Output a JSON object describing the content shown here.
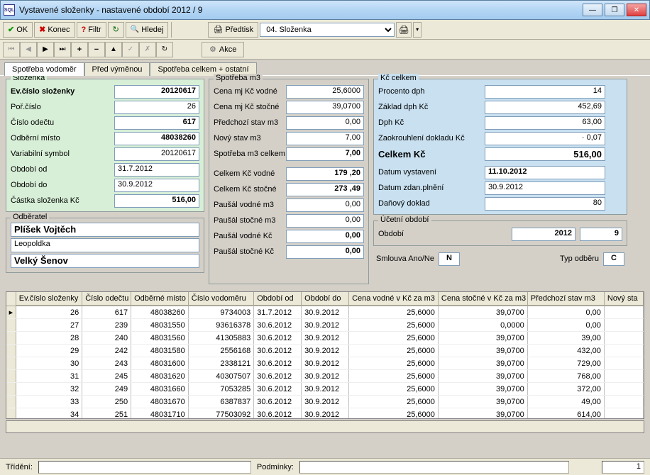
{
  "window": {
    "title": "Vystavené složenky - nastavené období 2012 / 9"
  },
  "toolbar": {
    "ok": "OK",
    "konec": "Konec",
    "filtr": "Filtr",
    "hledej": "Hledej",
    "predtisk": "Předtisk",
    "combo": "04. Složenka",
    "akce": "Akce"
  },
  "tabs": {
    "t1": "Spotřeba vodoměr",
    "t2": "Před výměnou",
    "t3": "Spotřeba celkem + ostatní"
  },
  "slozenka": {
    "legend": "Složenka",
    "evcislo_lbl": "Ev.číslo složenky",
    "evcislo": "20120617",
    "porcislo_lbl": "Poř.číslo",
    "porcislo": "26",
    "cisloodectu_lbl": "Číslo odečtu",
    "cisloodectu": "617",
    "odbmisto_lbl": "Odběrní místo",
    "odbmisto": "48038260",
    "vs_lbl": "Variabilní symbol",
    "vs": "20120617",
    "obdod_lbl": "Období od",
    "obdod": "31.7.2012",
    "obddo_lbl": "Období do",
    "obddo": "30.9.2012",
    "castka_lbl": "Částka složenka Kč",
    "castka": "516,00"
  },
  "odberatel": {
    "legend": "Odběratel",
    "name": "Plíšek Vojtěch",
    "street": "Leopoldka",
    "city": "Velký Šenov"
  },
  "spotreba": {
    "legend": "Spotřeba m3",
    "cenav_lbl": "Cena mj Kč vodné",
    "cenav": "25,6000",
    "cenas_lbl": "Cena mj Kč stočné",
    "cenas": "39,0700",
    "predstav_lbl": "Předchozí stav m3",
    "predstav": "0,00",
    "novystav_lbl": "Nový stav m3",
    "novystav": "7,00",
    "celkemm3_lbl": "Spotřeba m3 celkem",
    "celkemm3": "7,00",
    "celkemv_lbl": "Celkem Kč vodné",
    "celkemv": "179 ,20",
    "celkems_lbl": "Celkem Kč stočné",
    "celkems": "273 ,49",
    "pvm3_lbl": "Paušál vodné m3",
    "pvm3": "0,00",
    "psm3_lbl": "Paušál stočné m3",
    "psm3": "0,00",
    "pvkc_lbl": "Paušál vodné Kč",
    "pvkc": "0,00",
    "pskc_lbl": "Paušál stočné Kč",
    "pskc": "0,00"
  },
  "kc": {
    "legend": "Kč celkem",
    "dphproc_lbl": "Procento dph",
    "dphproc": "14",
    "zaklad_lbl": "Základ dph Kč",
    "zaklad": "452,69",
    "dphkc_lbl": "Dph Kč",
    "dphkc": "63,00",
    "zaok_lbl": "Zaokrouhlení dokladu Kč",
    "zaok": "·   0,07",
    "celkem_lbl": "Celkem Kč",
    "celkem": "516,00",
    "datvyst_lbl": "Datum vystavení",
    "datvyst": "11.10.2012",
    "datzdan_lbl": "Datum zdan.plnění",
    "datzdan": "30.9.2012",
    "dandokl_lbl": "Daňový doklad",
    "dandokl": "80"
  },
  "ucet": {
    "legend": "Účetní období",
    "obdobi_lbl": "Období",
    "rok": "2012",
    "mes": "9",
    "smlouva_lbl": "Smlouva Ano/Ne",
    "smlouva": "N",
    "typ_lbl": "Typ odběru",
    "typ": "C"
  },
  "grid": {
    "headers": {
      "ev": "Ev.číslo složenky",
      "od": "Číslo odečtu",
      "om": "Odběrné místo",
      "vod": "Číslo vodoměru",
      "obo": "Období od",
      "obd": "Období do",
      "cv": "Cena vodné v Kč za m3",
      "cs": "Cena stočné v Kč za m3",
      "ps": "Předchozí stav m3",
      "ns": "Nový sta"
    },
    "rows": [
      {
        "ev": "26",
        "od": "617",
        "om": "48038260",
        "vod": "9734003",
        "obo": "31.7.2012",
        "obd": "30.9.2012",
        "cv": "25,6000",
        "cs": "39,0700",
        "ps": "0,00"
      },
      {
        "ev": "27",
        "od": "239",
        "om": "48031550",
        "vod": "93616378",
        "obo": "30.6.2012",
        "obd": "30.9.2012",
        "cv": "25,6000",
        "cs": "0,0000",
        "ps": "0,00"
      },
      {
        "ev": "28",
        "od": "240",
        "om": "48031560",
        "vod": "41305883",
        "obo": "30.6.2012",
        "obd": "30.9.2012",
        "cv": "25,6000",
        "cs": "39,0700",
        "ps": "39,00"
      },
      {
        "ev": "29",
        "od": "242",
        "om": "48031580",
        "vod": "2556168",
        "obo": "30.6.2012",
        "obd": "30.9.2012",
        "cv": "25,6000",
        "cs": "39,0700",
        "ps": "432,00"
      },
      {
        "ev": "30",
        "od": "243",
        "om": "48031600",
        "vod": "2338121",
        "obo": "30.6.2012",
        "obd": "30.9.2012",
        "cv": "25,6000",
        "cs": "39,0700",
        "ps": "729,00"
      },
      {
        "ev": "31",
        "od": "245",
        "om": "48031620",
        "vod": "40307507",
        "obo": "30.6.2012",
        "obd": "30.9.2012",
        "cv": "25,6000",
        "cs": "39,0700",
        "ps": "768,00"
      },
      {
        "ev": "32",
        "od": "249",
        "om": "48031660",
        "vod": "7053285",
        "obo": "30.6.2012",
        "obd": "30.9.2012",
        "cv": "25,6000",
        "cs": "39,0700",
        "ps": "372,00"
      },
      {
        "ev": "33",
        "od": "250",
        "om": "48031670",
        "vod": "6387837",
        "obo": "30.6.2012",
        "obd": "30.9.2012",
        "cv": "25,6000",
        "cs": "39,0700",
        "ps": "49,00"
      },
      {
        "ev": "34",
        "od": "251",
        "om": "48031710",
        "vod": "77503092",
        "obo": "30.6.2012",
        "obd": "30.9.2012",
        "cv": "25,6000",
        "cs": "39,0700",
        "ps": "614,00"
      }
    ]
  },
  "status": {
    "trideni_lbl": "Třídění:",
    "podminky_lbl": "Podmínky:",
    "count": "1"
  }
}
